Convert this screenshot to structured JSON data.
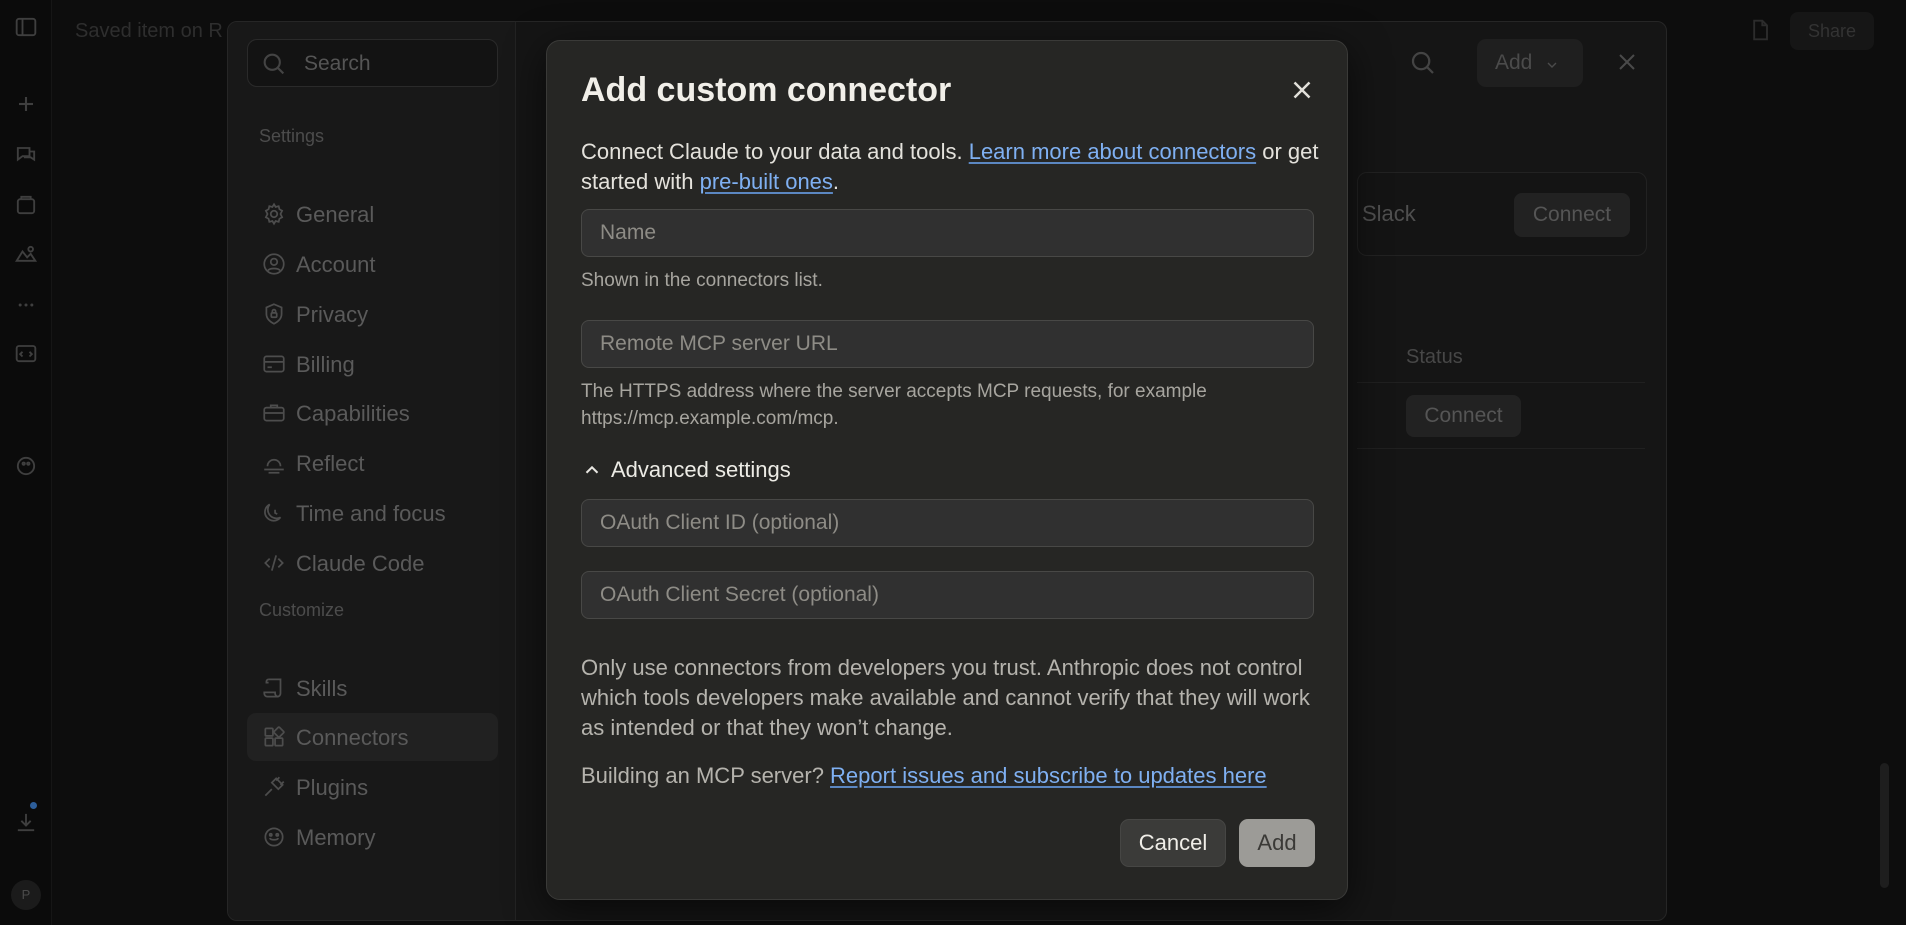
{
  "background": {
    "app_title": "Saved item on R",
    "share_label": "Share"
  },
  "settings": {
    "search_placeholder": "Search",
    "sections": [
      {
        "label": "Settings",
        "items": [
          {
            "label": "General",
            "icon": "gear-icon"
          },
          {
            "label": "Account",
            "icon": "user-circle-icon"
          },
          {
            "label": "Privacy",
            "icon": "shield-lock-icon"
          },
          {
            "label": "Billing",
            "icon": "credit-card-icon"
          },
          {
            "label": "Capabilities",
            "icon": "briefcase-icon"
          },
          {
            "label": "Reflect",
            "icon": "sunrise-icon"
          },
          {
            "label": "Time and focus",
            "icon": "moon-clock-icon"
          },
          {
            "label": "Claude Code",
            "icon": "code-icon"
          }
        ]
      },
      {
        "label": "Customize",
        "items": [
          {
            "label": "Skills",
            "icon": "scroll-icon"
          },
          {
            "label": "Connectors",
            "icon": "blocks-icon",
            "active": true
          },
          {
            "label": "Plugins",
            "icon": "plug-icon"
          },
          {
            "label": "Memory",
            "icon": "memory-icon"
          }
        ]
      }
    ],
    "main": {
      "add_label": "Add",
      "card_label": "Slack",
      "card_button": "Connect",
      "status_header": "Status",
      "row_button": "Connect"
    }
  },
  "modal": {
    "title": "Add custom connector",
    "intro_text": "Connect Claude to your data and tools. ",
    "intro_link1": "Learn more about connectors",
    "intro_mid": " or get started with ",
    "intro_link2": "pre-built ones",
    "intro_end": ".",
    "name_placeholder": "Name",
    "name_hint": "Shown in the connectors list.",
    "url_placeholder": "Remote MCP server URL",
    "url_hint": "The HTTPS address where the server accepts MCP requests, for example https://mcp.example.com/mcp.",
    "advanced_label": "Advanced settings",
    "advanced_expanded": true,
    "client_id_placeholder": "OAuth Client ID (optional)",
    "client_secret_placeholder": "OAuth Client Secret (optional)",
    "warning": "Only use connectors from developers you trust. Anthropic does not control which tools developers make available and cannot verify that they will work as intended or that they won’t change.",
    "mcp_prefix": "Building an MCP server? ",
    "mcp_link": "Report issues and subscribe to updates here",
    "cancel_label": "Cancel",
    "add_label": "Add",
    "add_disabled": true
  },
  "colors": {
    "modal_bg": "#262624",
    "link": "#7fb0f2",
    "add_disabled_bg": "#9c9b97"
  }
}
